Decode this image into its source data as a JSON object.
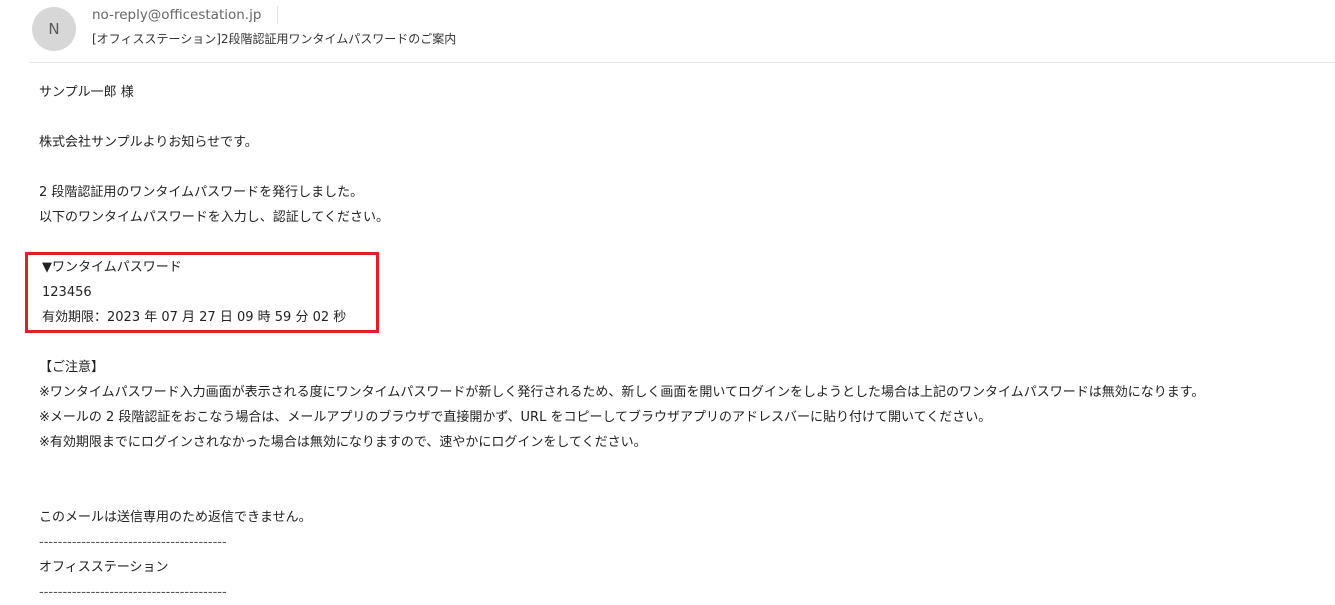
{
  "header": {
    "avatar_initial": "N",
    "sender": "no-reply@officestation.jp",
    "subject": "[オフィスステーション]2段階認証用ワンタイムパスワードのご案内"
  },
  "body": {
    "greeting": "サンプル一郎 様",
    "intro": "株式会社サンプルよりお知らせです。",
    "issued": "2 段階認証用のワンタイムパスワードを発行しました。",
    "instruction": "以下のワンタイムパスワードを入力し、認証してください。",
    "otp": {
      "heading": "▼ワンタイムパスワード",
      "code": "123456",
      "expiry": "有効期限：2023 年 07 月 27 日 09 時 59 分 02 秒"
    },
    "notes": {
      "heading": "【ご注意】",
      "items": [
        "※ワンタイムパスワード入力画面が表示される度にワンタイムパスワードが新しく発行されるため、新しく画面を開いてログインをしようとした場合は上記のワンタイムパスワードは無効になります。",
        "※メールの 2 段階認証をおこなう場合は、メールアプリのブラウザで直接開かず、URL をコピーしてブラウザアプリのアドレスバーに貼り付けて開いてください。",
        "※有効期限までにログインされなかった場合は無効になりますので、速やかにログインをしてください。"
      ]
    },
    "footer": {
      "no_reply": "このメールは送信専用のため返信できません。",
      "divider": "----------------------------------------",
      "company": "オフィスステーション",
      "divider_bottom": "----------------------------------------"
    }
  },
  "colors": {
    "highlight_border": "#e31e24",
    "avatar_bg": "#d7d7d7"
  }
}
